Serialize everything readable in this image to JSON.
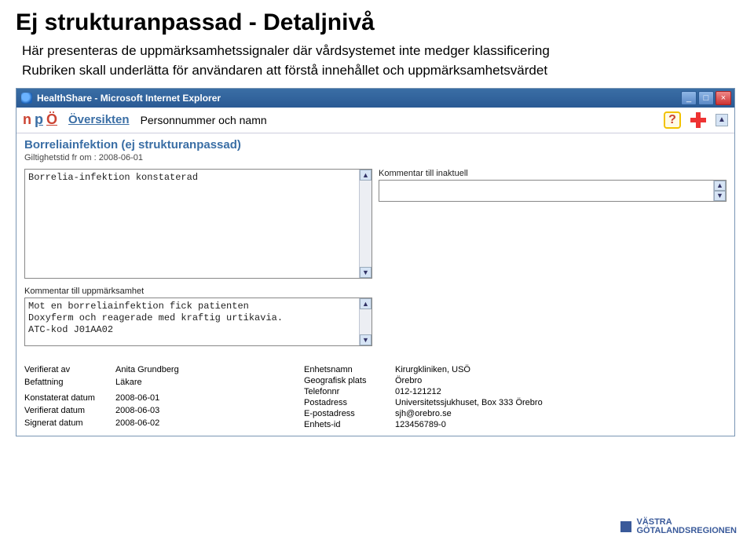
{
  "slide": {
    "title": "Ej strukturanpassad - Detaljnivå",
    "line1": "Här presenteras de uppmärksamhetssignaler där vårdsystemet inte medger klassificering",
    "line2": "Rubriken skall underlätta för användaren att förstå innehållet och uppmärksamhetsvärdet"
  },
  "browser": {
    "window_title": "HealthShare - Microsoft Internet Explorer",
    "logo_n": "n",
    "logo_p": "p",
    "logo_o": "Ö",
    "overview_link": "Översikten",
    "person_placeholder": "Personnummer och namn",
    "help_glyph": "?",
    "scroll_up_glyph": "▲",
    "scroll_dn_glyph": "▼"
  },
  "detail": {
    "diagnosis_title": "Borreliainfektion (ej strukturanpassad)",
    "validity_label": "Giltighetstid fr om : 2008-06-01",
    "konstaterad_text": "Borrelia-infektion konstaterad",
    "kommentar_inaktuell_label": "Kommentar till inaktuell",
    "kommentar_inaktuell_text": "",
    "kommentar_uppm_label": "Kommentar till uppmärksamhet",
    "kommentar_uppm_text": "Mot en borreliainfektion fick patienten\nDoxyferm och reagerade med kraftig urtikavia.\nATC-kod J01AA02"
  },
  "meta_left": [
    {
      "k": "Verifierat av",
      "v": "Anita Grundberg"
    },
    {
      "k": "Befattning",
      "v": "Läkare"
    },
    {
      "k": "",
      "v": ""
    },
    {
      "k": "Konstaterat datum",
      "v": "2008-06-01"
    },
    {
      "k": "Verifierat datum",
      "v": "2008-06-03"
    },
    {
      "k": "Signerat datum",
      "v": "2008-06-02"
    }
  ],
  "meta_right": [
    {
      "k": "Enhetsnamn",
      "v": "Kirurgkliniken, USÖ"
    },
    {
      "k": "Geografisk plats",
      "v": "Örebro"
    },
    {
      "k": "Telefonnr",
      "v": "012-121212"
    },
    {
      "k": "Postadress",
      "v": "Universitetssjukhuset, Box 333 Örebro"
    },
    {
      "k": "E-postadress",
      "v": "sjh@orebro.se"
    },
    {
      "k": "Enhets-id",
      "v": "123456789-0"
    }
  ],
  "footer": {
    "line1": "VÄSTRA",
    "line2": "GÖTALANDSREGIONEN"
  }
}
